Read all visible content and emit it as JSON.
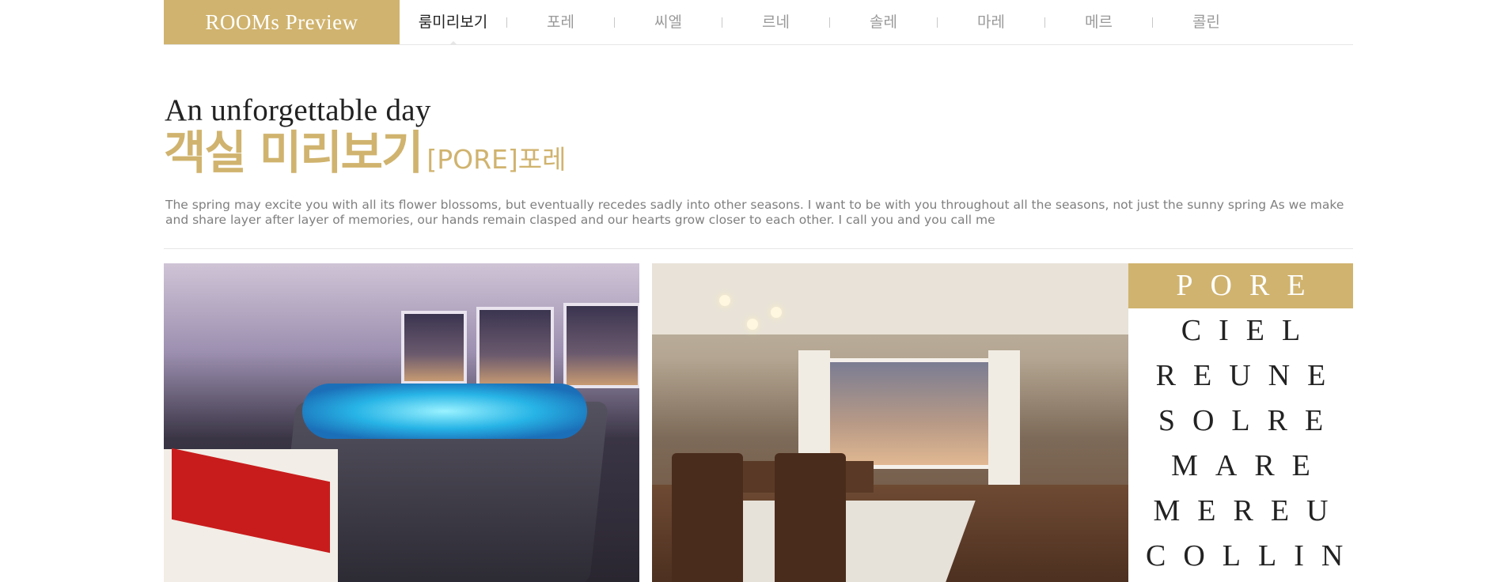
{
  "brand": {
    "label": "ROOMs Preview"
  },
  "nav": {
    "items": [
      {
        "label": "룸미리보기",
        "active": true
      },
      {
        "label": "포레",
        "active": false
      },
      {
        "label": "씨엘",
        "active": false
      },
      {
        "label": "르네",
        "active": false
      },
      {
        "label": "솔레",
        "active": false
      },
      {
        "label": "마레",
        "active": false
      },
      {
        "label": "메르",
        "active": false
      },
      {
        "label": "콜린",
        "active": false
      }
    ]
  },
  "heading": {
    "tagline": "An unforgettable day",
    "title": "객실 미리보기",
    "subtitle": "[PORE]포레"
  },
  "description": "The spring may excite you with all its flower blossoms, but eventually recedes sadly into other seasons. I want to be with you throughout all the seasons, not just the sunny spring As we make and share layer after layer of memories, our hands remain clasped and our hearts grow closer to each other. I call you and you call me",
  "rooms": {
    "items": [
      {
        "label": "PORE",
        "active": true
      },
      {
        "label": "CIEL",
        "active": false
      },
      {
        "label": "REUNE",
        "active": false
      },
      {
        "label": "SOLRE",
        "active": false
      },
      {
        "label": "MARE",
        "active": false
      },
      {
        "label": "MEREU",
        "active": false
      },
      {
        "label": "COLLIN",
        "active": false
      }
    ]
  },
  "colors": {
    "accent": "#d0b36e",
    "text_dark": "#222222",
    "text_muted": "#7f7f7f"
  }
}
